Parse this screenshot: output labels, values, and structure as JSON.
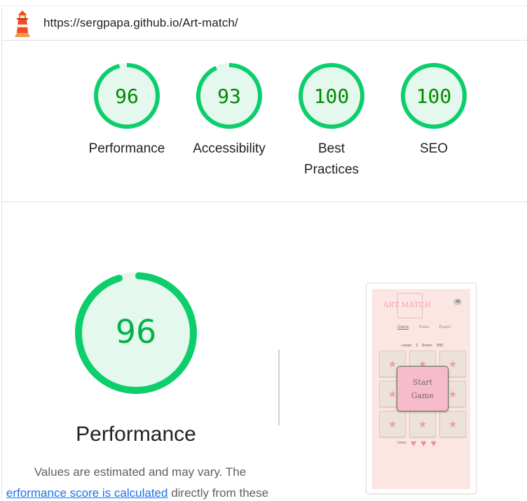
{
  "header": {
    "url": "https://sergpapa.github.io/Art-match/"
  },
  "gauges": [
    {
      "label": "Performance",
      "score": "96",
      "value": 96
    },
    {
      "label": "Accessibility",
      "score": "93",
      "value": 93
    },
    {
      "label": "Best Practices",
      "score": "100",
      "value": 100
    },
    {
      "label": "SEO",
      "score": "100",
      "value": 100
    }
  ],
  "performance": {
    "score": "96",
    "value": 96,
    "title": "Performance",
    "desc_line1": "Values are estimated and may vary. The",
    "desc_link": "erformance score is calculated",
    "desc_line2_rest": " directly from these"
  },
  "screenshot": {
    "logo": "ART MATCH",
    "nav": [
      "Game",
      "Rules",
      "Board"
    ],
    "stats": "Level: 1 Score: 000",
    "start_button": "Start\nGame",
    "lives_label": "Lives",
    "card_symbol": "★",
    "heart_symbol": "♥"
  },
  "colors": {
    "pass_green": "#0cce6b",
    "pass_fill": "#e5f8ee",
    "score_text": "#008a00",
    "link": "#1a73e8",
    "thumbnail_bg": "#fce6e3",
    "card_pink": "#ef9bb1"
  }
}
